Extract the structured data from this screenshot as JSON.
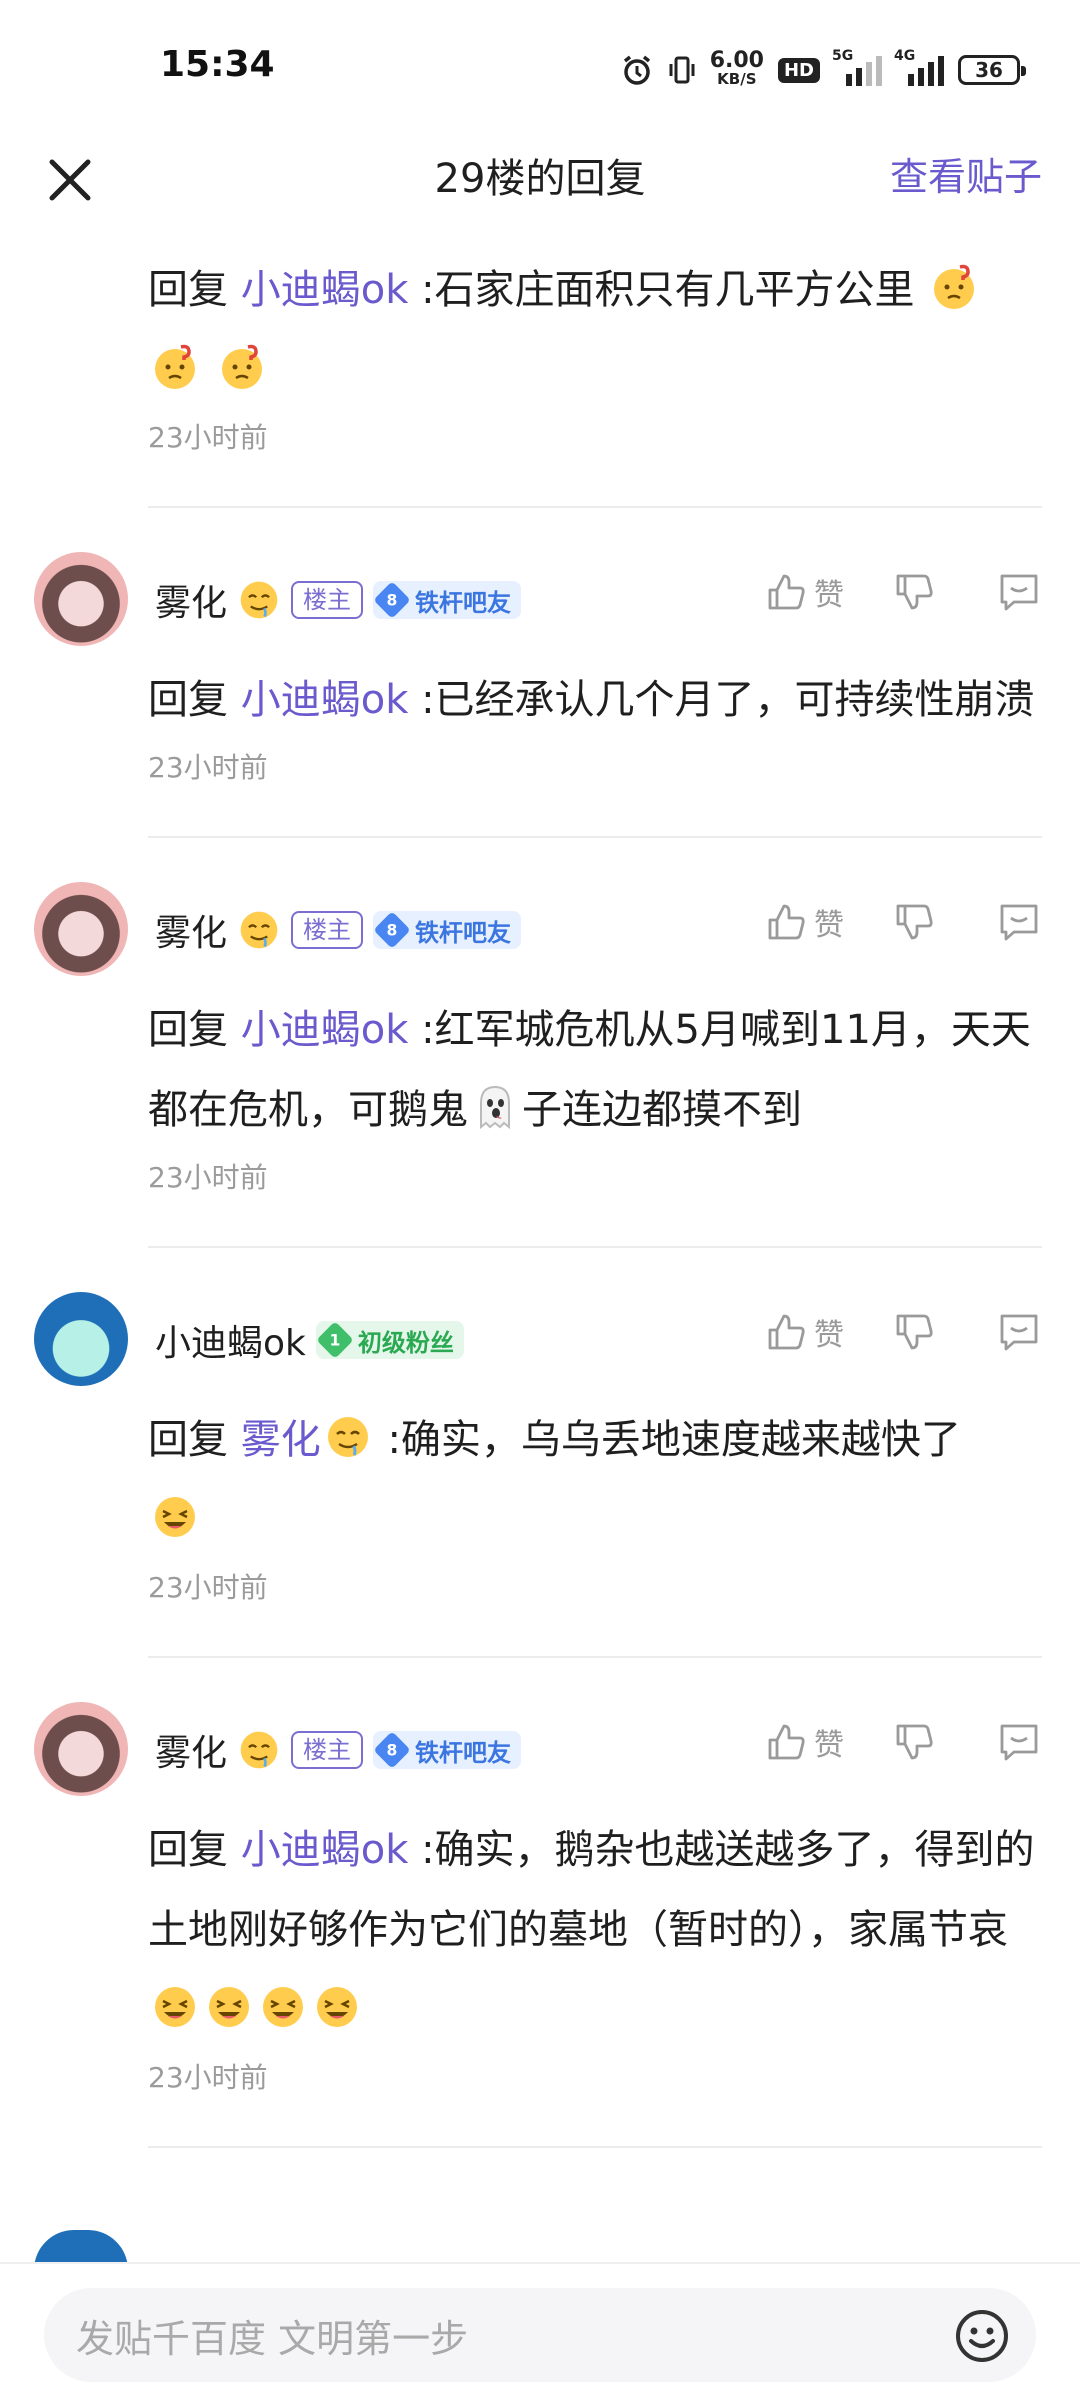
{
  "status_bar": {
    "time": "15:34",
    "net_speed_value": "6.00",
    "net_speed_unit": "KB/S",
    "hd_label": "HD",
    "sig1_label": "5G",
    "sig2_label": "4G",
    "battery": "36"
  },
  "header": {
    "title": "29楼的回复",
    "view_post_label": "查看贴子"
  },
  "replies": [
    {
      "prefix": "回复",
      "mention": "小迪蝎ok",
      "text": ":石家庄面积只有几平方公里",
      "trail_emojis": [
        "thinking",
        "thinking",
        "thinking"
      ],
      "time": "23小时前"
    },
    {
      "username": "雾化",
      "host_tag": "楼主",
      "level": "8",
      "level_name": "铁杆吧友",
      "like_label": "赞",
      "prefix": "回复",
      "mention": "小迪蝎ok",
      "text": ":已经承认几个月了，可持续性崩溃",
      "time": "23小时前"
    },
    {
      "username": "雾化",
      "host_tag": "楼主",
      "level": "8",
      "level_name": "铁杆吧友",
      "like_label": "赞",
      "prefix": "回复",
      "mention": "小迪蝎ok",
      "text_a": ":红军城危机从5月喊到11月，天天都在危机，可鹅鬼",
      "text_b": "子连边都摸不到",
      "time": "23小时前"
    },
    {
      "username": "小迪蝎ok",
      "level": "1",
      "level_name": "初级粉丝",
      "like_label": "赞",
      "prefix": "回复",
      "mention": "雾化",
      "text": ":确实，乌乌丢地速度越来越快了",
      "time": "23小时前"
    },
    {
      "username": "雾化",
      "host_tag": "楼主",
      "level": "8",
      "level_name": "铁杆吧友",
      "like_label": "赞",
      "prefix": "回复",
      "mention": "小迪蝎ok",
      "text": ":确实，鹅杂也越送越多了，得到的土地刚好够作为它们的墓地（暂时的），家属节哀",
      "time": "23小时前"
    }
  ],
  "bottom_bar": {
    "placeholder": "发贴千百度 文明第一步"
  },
  "colors": {
    "accent": "#6a5acd",
    "level_blue": "#4a86f2",
    "level_green": "#3fbf69",
    "muted": "#9b9b9b"
  }
}
